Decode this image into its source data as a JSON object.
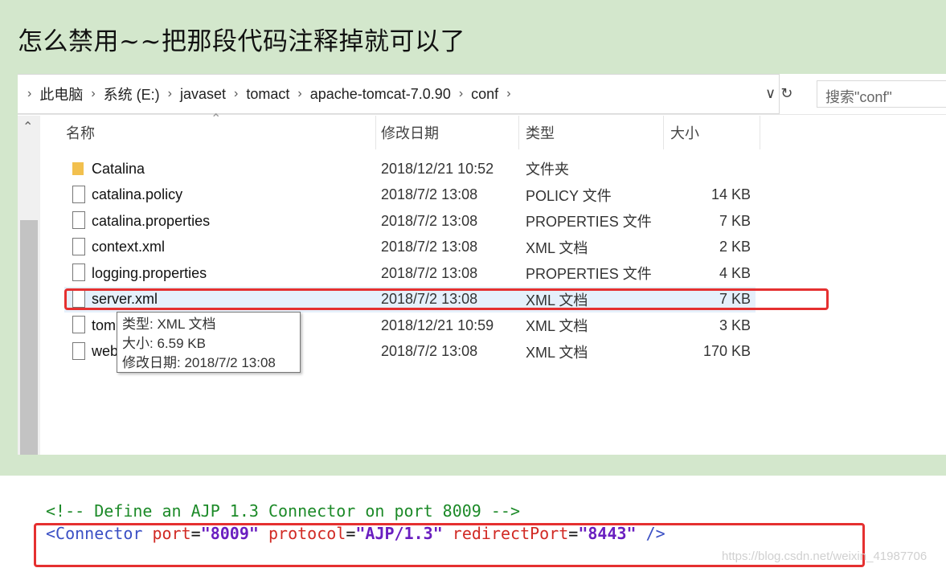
{
  "heading": "怎么禁用~~把那段代码注释掉就可以了",
  "address": {
    "crumbs": [
      "此电脑",
      "系统 (E:)",
      "javaset",
      "tomact",
      "apache-tomcat-7.0.90",
      "conf"
    ],
    "dropdown_glyph": "∨",
    "refresh_glyph": "↻",
    "search_placeholder": "搜索\"conf\""
  },
  "columns": {
    "name": "名称",
    "date": "修改日期",
    "type": "类型",
    "size": "大小"
  },
  "files": [
    {
      "name": "Catalina",
      "date": "2018/12/21 10:52",
      "type": "文件夹",
      "size": "",
      "icon": "folder-icon"
    },
    {
      "name": "catalina.policy",
      "date": "2018/7/2 13:08",
      "type": "POLICY 文件",
      "size": "14 KB",
      "icon": "file-icon"
    },
    {
      "name": "catalina.properties",
      "date": "2018/7/2 13:08",
      "type": "PROPERTIES 文件",
      "size": "7 KB",
      "icon": "file-icon"
    },
    {
      "name": "context.xml",
      "date": "2018/7/2 13:08",
      "type": "XML 文档",
      "size": "2 KB",
      "icon": "file-icon"
    },
    {
      "name": "logging.properties",
      "date": "2018/7/2 13:08",
      "type": "PROPERTIES 文件",
      "size": "4 KB",
      "icon": "file-icon"
    },
    {
      "name": "server.xml",
      "date": "2018/7/2 13:08",
      "type": "XML 文档",
      "size": "7 KB",
      "icon": "file-icon",
      "selected": true
    },
    {
      "name": "tom",
      "date": "2018/12/21 10:59",
      "type": "XML 文档",
      "size": "3 KB",
      "icon": "file-icon"
    },
    {
      "name": "web",
      "date": "2018/7/2 13:08",
      "type": "XML 文档",
      "size": "170 KB",
      "icon": "file-icon"
    }
  ],
  "tooltip": {
    "line1": "类型: XML 文档",
    "line2": "大小: 6.59 KB",
    "line3": "修改日期: 2018/7/2 13:08"
  },
  "code": {
    "comment": "<!-- Define an AJP 1.3 Connector on port 8009 -->",
    "tag_open": "<Connector",
    "attr1": "port",
    "val1": "\"8009\"",
    "attr2": "protocol",
    "val2": "\"AJP/1.3\"",
    "attr3": "redirectPort",
    "val3": "\"8443\"",
    "tag_close": "/>"
  },
  "watermark": "https://blog.csdn.net/weixin_41987706",
  "colors": {
    "page_bg": "#d3e7cc",
    "highlight_red": "#e53030",
    "selected_row": "#e5f0fb"
  }
}
